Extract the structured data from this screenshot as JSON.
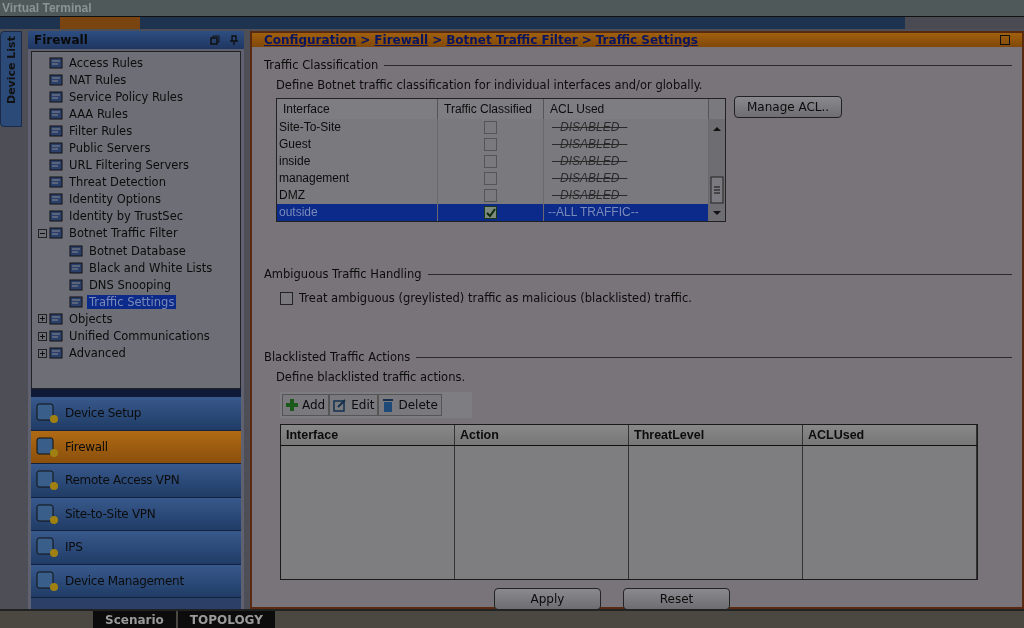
{
  "window": {
    "title": "Virtual Terminal"
  },
  "device_list_tab": {
    "label": "Device List"
  },
  "nav_panel": {
    "title": "Firewall",
    "tree": [
      {
        "label": "Access Rules",
        "kind": "leaf",
        "selected": false
      },
      {
        "label": "NAT Rules",
        "kind": "leaf",
        "selected": false
      },
      {
        "label": "Service Policy Rules",
        "kind": "leaf",
        "selected": false
      },
      {
        "label": "AAA Rules",
        "kind": "leaf",
        "selected": false
      },
      {
        "label": "Filter Rules",
        "kind": "leaf",
        "selected": false
      },
      {
        "label": "Public Servers",
        "kind": "leaf",
        "selected": false
      },
      {
        "label": "URL Filtering Servers",
        "kind": "leaf",
        "selected": false
      },
      {
        "label": "Threat Detection",
        "kind": "leaf",
        "selected": false
      },
      {
        "label": "Identity Options",
        "kind": "leaf",
        "selected": false
      },
      {
        "label": "Identity by TrustSec",
        "kind": "leaf",
        "selected": false
      },
      {
        "label": "Botnet Traffic Filter",
        "kind": "branch",
        "expanded": true,
        "selected": false,
        "children": [
          {
            "label": "Botnet Database",
            "selected": false
          },
          {
            "label": "Black and White Lists",
            "selected": false
          },
          {
            "label": "DNS Snooping",
            "selected": false
          },
          {
            "label": "Traffic Settings",
            "selected": true
          }
        ]
      },
      {
        "label": "Objects",
        "kind": "branch",
        "expanded": false,
        "selected": false
      },
      {
        "label": "Unified Communications",
        "kind": "branch",
        "expanded": false,
        "selected": false
      },
      {
        "label": "Advanced",
        "kind": "branch",
        "expanded": false,
        "selected": false
      }
    ]
  },
  "nav_buttons": [
    {
      "label": "Device Setup",
      "selected": false
    },
    {
      "label": "Firewall",
      "selected": true
    },
    {
      "label": "Remote Access VPN",
      "selected": false
    },
    {
      "label": "Site-to-Site VPN",
      "selected": false
    },
    {
      "label": "IPS",
      "selected": false
    },
    {
      "label": "Device Management",
      "selected": false
    }
  ],
  "breadcrumb": {
    "separator": ">",
    "items": [
      "Configuration",
      "Firewall",
      "Botnet Traffic Filter",
      "Traffic Settings"
    ]
  },
  "traffic_classification": {
    "title": "Traffic Classification",
    "description": "Define Botnet traffic classification for individual interfaces and/or globally.",
    "manage_button": "Manage ACL..",
    "columns": [
      "Interface",
      "Traffic Classified",
      "ACL Used"
    ],
    "rows": [
      {
        "interface": "Site-To-Site",
        "traffic_classified": false,
        "acl_used": "--DISABLED--",
        "selected": false
      },
      {
        "interface": "Guest",
        "traffic_classified": false,
        "acl_used": "--DISABLED--",
        "selected": false
      },
      {
        "interface": "inside",
        "traffic_classified": false,
        "acl_used": "--DISABLED--",
        "selected": false
      },
      {
        "interface": "management",
        "traffic_classified": false,
        "acl_used": "--DISABLED--",
        "selected": false
      },
      {
        "interface": "DMZ",
        "traffic_classified": false,
        "acl_used": "--DISABLED--",
        "selected": false
      },
      {
        "interface": "outside",
        "traffic_classified": true,
        "acl_used": "--ALL TRAFFIC--",
        "selected": true
      }
    ]
  },
  "ambiguous_traffic": {
    "title": "Ambiguous Traffic Handling",
    "checkbox": {
      "label": "Treat ambiguous (greylisted) traffic as malicious (blacklisted) traffic.",
      "checked": false
    }
  },
  "blacklisted_actions": {
    "title": "Blacklisted Traffic Actions",
    "description": "Define blacklisted traffic actions.",
    "toolbar": [
      "Add",
      "Edit",
      "Delete"
    ],
    "columns": [
      "Interface",
      "Action",
      "ThreatLevel",
      "ACLUsed"
    ]
  },
  "buttons": [
    "Apply",
    "Reset"
  ],
  "bottom_tabs": [
    "Scenario",
    "TOPOLOGY"
  ]
}
